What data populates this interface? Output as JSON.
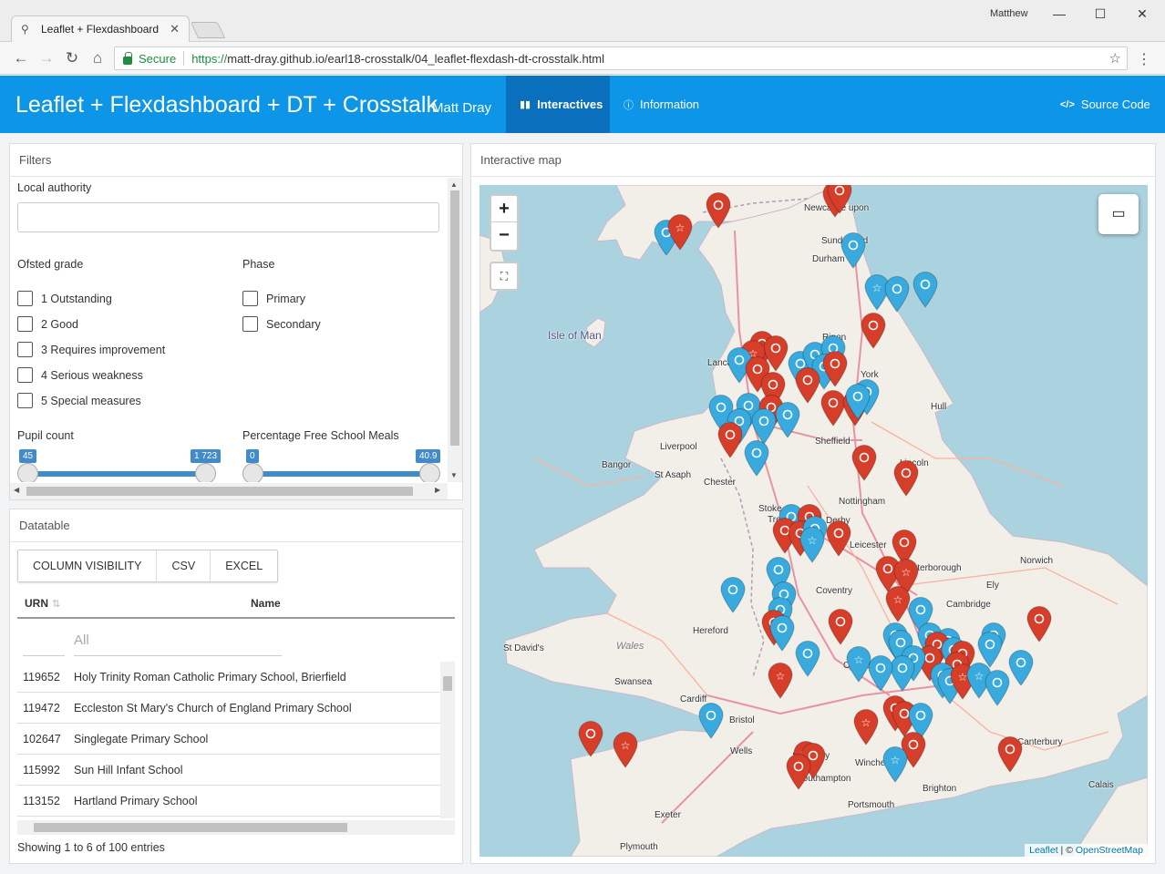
{
  "browser": {
    "tab_title": "Leaflet + Flexdashboard",
    "user": "Matthew",
    "secure_label": "Secure",
    "url_scheme": "https://",
    "url_rest": "matt-dray.github.io/earl18-crosstalk/04_leaflet-flexdash-dt-crosstalk.html"
  },
  "navbar": {
    "title": "Leaflet + Flexdashboard + DT + Crosstalk",
    "author": "Matt Dray",
    "tabs": [
      {
        "label": "Interactives",
        "icon": "bar-chart-icon"
      },
      {
        "label": "Information",
        "icon": "info-icon"
      }
    ],
    "source_code": "Source Code",
    "color": "#0d95e8",
    "active_color": "#0a6fbd"
  },
  "filters": {
    "title": "Filters",
    "local_authority_label": "Local authority",
    "ofsted_label": "Ofsted grade",
    "ofsted_options": [
      "1 Outstanding",
      "2 Good",
      "3 Requires improvement",
      "4 Serious weakness",
      "5 Special measures"
    ],
    "phase_label": "Phase",
    "phase_options": [
      "Primary",
      "Secondary"
    ],
    "pupil_count": {
      "label": "Pupil count",
      "min": "45",
      "max": "1 723"
    },
    "fsm": {
      "label": "Percentage Free School Meals",
      "min": "0",
      "max": "40.9"
    }
  },
  "datatable": {
    "title": "Datatable",
    "buttons": [
      "COLUMN VISIBILITY",
      "CSV",
      "EXCEL"
    ],
    "columns": [
      "URN",
      "Name"
    ],
    "name_filter_placeholder": "All",
    "rows": [
      {
        "urn": "119652",
        "name": "Holy Trinity Roman Catholic Primary School, Brierfield"
      },
      {
        "urn": "119472",
        "name": "Eccleston St Mary's Church of England Primary School"
      },
      {
        "urn": "102647",
        "name": "Singlegate Primary School"
      },
      {
        "urn": "115992",
        "name": "Sun Hill Infant School"
      },
      {
        "urn": "113152",
        "name": "Hartland Primary School"
      }
    ],
    "info": "Showing 1 to 6 of 100 entries"
  },
  "map": {
    "title": "Interactive map",
    "zoom_in": "+",
    "zoom_out": "−",
    "attribution_leaflet": "Leaflet",
    "attribution_sep": " | © ",
    "attribution_osm": "OpenStreetMap",
    "sea_color": "#aad3df",
    "land_color": "#f2efe9",
    "places": [
      {
        "name": "Isle of Man",
        "cls": "iom"
      },
      {
        "name": "Wales",
        "cls": "wales"
      },
      {
        "name": "Sunderland"
      },
      {
        "name": "Durham"
      },
      {
        "name": "Ripon"
      },
      {
        "name": "York"
      },
      {
        "name": "Lancaster"
      },
      {
        "name": "Hull"
      },
      {
        "name": "Liverpool"
      },
      {
        "name": "Sheffield"
      },
      {
        "name": "Bangor"
      },
      {
        "name": "St Asaph"
      },
      {
        "name": "Chester"
      },
      {
        "name": "Lincoln"
      },
      {
        "name": "Stoke-on-"
      },
      {
        "name": "Trent"
      },
      {
        "name": "Nottingham"
      },
      {
        "name": "Derby"
      },
      {
        "name": "Leicester"
      },
      {
        "name": "Peterborough"
      },
      {
        "name": "Norwich"
      },
      {
        "name": "Ely"
      },
      {
        "name": "Coventry"
      },
      {
        "name": "Hereford"
      },
      {
        "name": "Cambridge"
      },
      {
        "name": "St David's"
      },
      {
        "name": "Oxford"
      },
      {
        "name": "Swansea"
      },
      {
        "name": "Cardiff"
      },
      {
        "name": "Bristol"
      },
      {
        "name": "Wells"
      },
      {
        "name": "Salisbury"
      },
      {
        "name": "Winchester"
      },
      {
        "name": "Canterbury"
      },
      {
        "name": "Southampton"
      },
      {
        "name": "Brighton"
      },
      {
        "name": "Portsmouth"
      },
      {
        "name": "Calais"
      },
      {
        "name": "Exeter"
      },
      {
        "name": "Plymouth"
      },
      {
        "name": "Newcastle upon"
      }
    ],
    "marker_colors": {
      "red": "#d63e2a",
      "blue": "#38aadd"
    }
  }
}
